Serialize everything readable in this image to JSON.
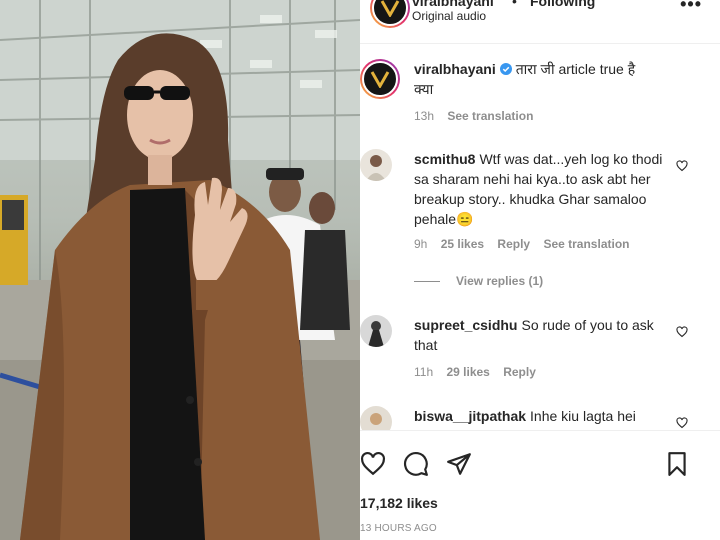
{
  "header": {
    "username": "viralbhayani",
    "separator": "•",
    "follow_status": "Following",
    "subtitle": "Original audio",
    "more": "•••"
  },
  "caption": {
    "username": "viralbhayani",
    "text": "तारा जी article true है क्या",
    "time": "13h",
    "translate": "See translation"
  },
  "comments": [
    {
      "username": "scmithu8",
      "text": "Wtf was dat...yeh log ko thodi sa sharam nehi hai kya..to ask abt her breakup story.. khudka Ghar samaloo pehale😑",
      "time": "9h",
      "likes": "25 likes",
      "reply": "Reply",
      "translate": "See translation",
      "view_replies": "View replies (1)"
    },
    {
      "username": "supreet_csidhu",
      "text": "So rude of you to ask that",
      "time": "11h",
      "likes": "29 likes",
      "reply": "Reply"
    },
    {
      "username": "biswa__jitpathak",
      "text": "Inhe kiu lagta hei"
    }
  ],
  "actions": {
    "icons": [
      "heart-icon",
      "comment-icon",
      "share-icon",
      "bookmark-icon"
    ],
    "likes": "17,182 likes",
    "posted": "13 HOURS AGO"
  },
  "colors": {
    "text": "#262626",
    "muted": "#8e8e8e",
    "verified": "#3897f0",
    "jacket": "#8a5a36"
  }
}
